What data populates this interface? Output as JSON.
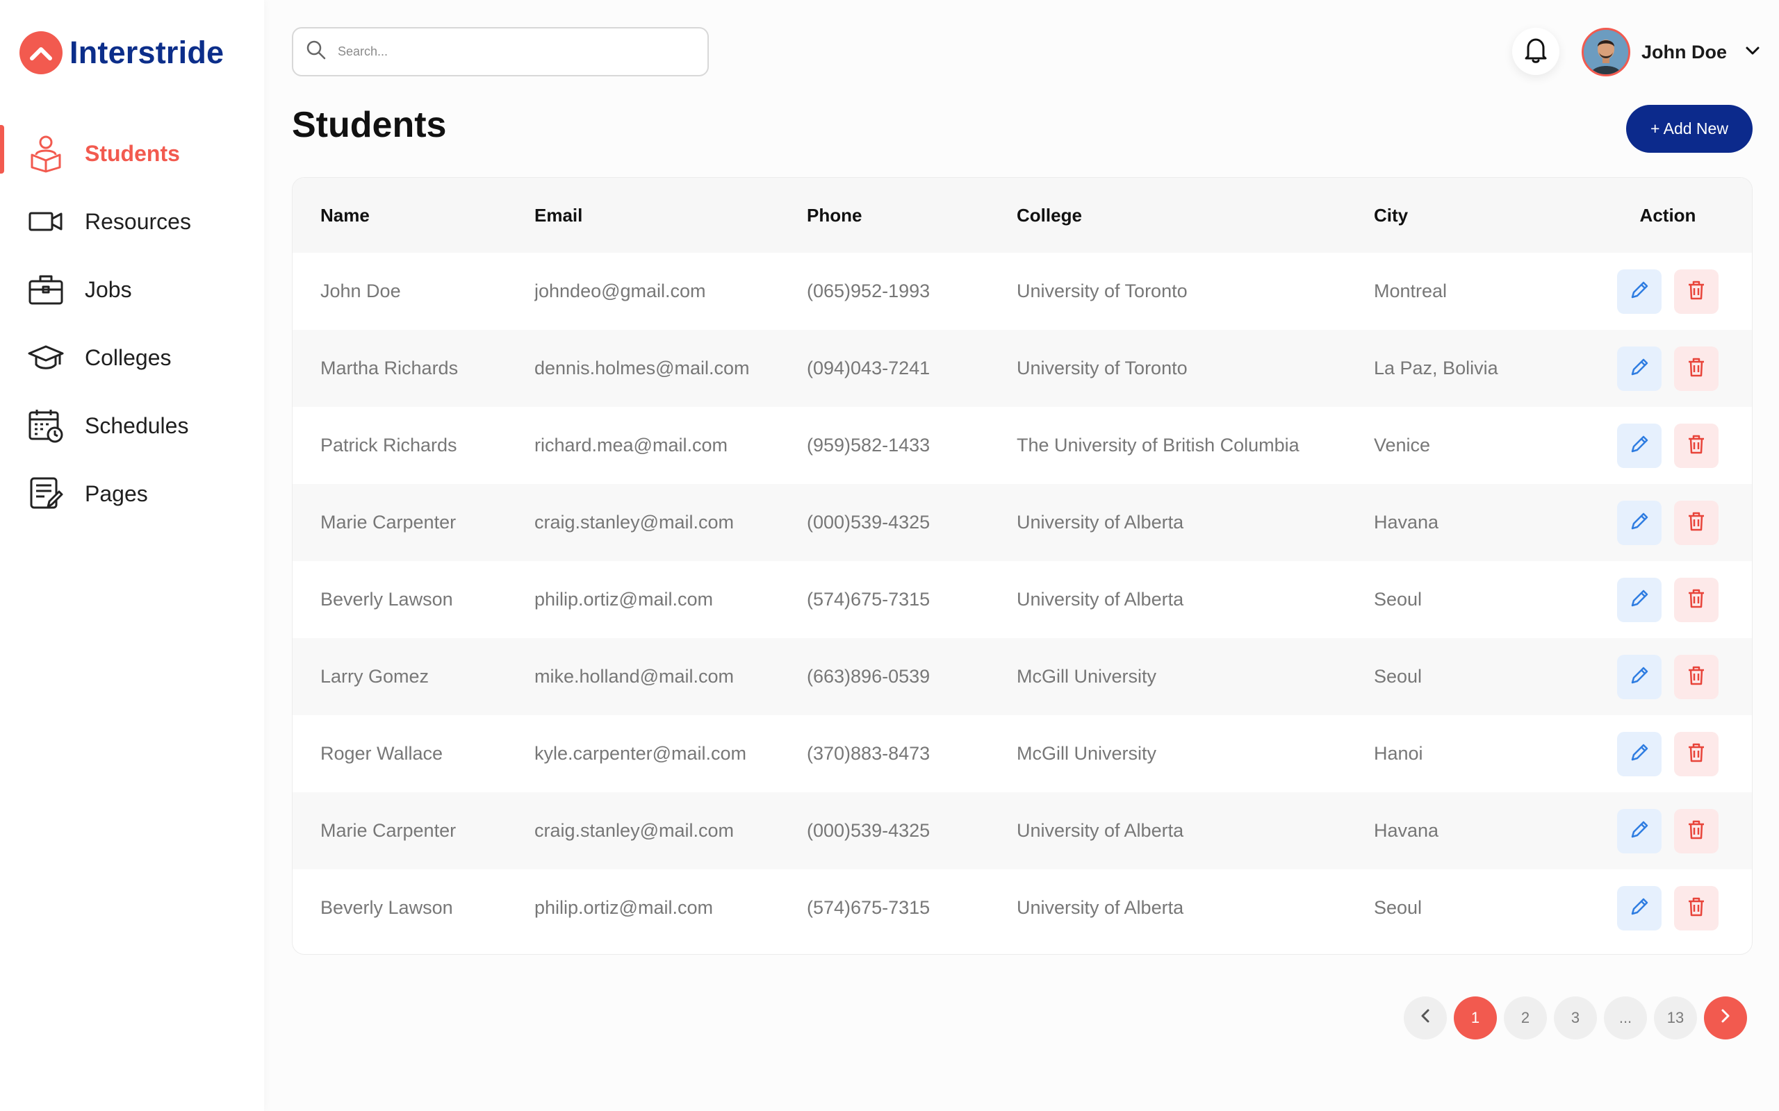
{
  "brand": {
    "name": "Interstride",
    "accent": "#f25a4f",
    "primary": "#0c2a8c"
  },
  "sidebar": {
    "items": [
      {
        "label": "Students",
        "icon": "student-icon",
        "active": true
      },
      {
        "label": "Resources",
        "icon": "video-camera-icon",
        "active": false
      },
      {
        "label": "Jobs",
        "icon": "briefcase-icon",
        "active": false
      },
      {
        "label": "Colleges",
        "icon": "graduation-cap-icon",
        "active": false
      },
      {
        "label": "Schedules",
        "icon": "calendar-clock-icon",
        "active": false
      },
      {
        "label": "Pages",
        "icon": "document-edit-icon",
        "active": false
      }
    ]
  },
  "header": {
    "search_placeholder": "Search...",
    "user_name": "John Doe"
  },
  "page": {
    "title": "Students",
    "add_button": "+ Add New"
  },
  "table": {
    "columns": [
      "Name",
      "Email",
      "Phone",
      "College",
      "City",
      "Action"
    ],
    "rows": [
      {
        "name": "John Doe",
        "email": "johndeo@gmail.com",
        "phone": "(065)952-1993",
        "college": "University of Toronto",
        "city": "Montreal"
      },
      {
        "name": "Martha Richards",
        "email": "dennis.holmes@mail.com",
        "phone": "(094)043-7241",
        "college": "University of Toronto",
        "city": "La Paz, Bolivia"
      },
      {
        "name": "Patrick Richards",
        "email": "richard.mea@mail.com",
        "phone": "(959)582-1433",
        "college": "The University of British Columbia",
        "city": "Venice"
      },
      {
        "name": "Marie Carpenter",
        "email": "craig.stanley@mail.com",
        "phone": "(000)539-4325",
        "college": "University of Alberta",
        "city": "Havana"
      },
      {
        "name": "Beverly Lawson",
        "email": "philip.ortiz@mail.com",
        "phone": "(574)675-7315",
        "college": "University of Alberta",
        "city": "Seoul"
      },
      {
        "name": "Larry Gomez",
        "email": "mike.holland@mail.com",
        "phone": "(663)896-0539",
        "college": "McGill University",
        "city": "Seoul"
      },
      {
        "name": "Roger Wallace",
        "email": "kyle.carpenter@mail.com",
        "phone": "(370)883-8473",
        "college": "McGill University",
        "city": "Hanoi"
      },
      {
        "name": "Marie Carpenter",
        "email": "craig.stanley@mail.com",
        "phone": "(000)539-4325",
        "college": "University of Alberta",
        "city": "Havana"
      },
      {
        "name": "Beverly Lawson",
        "email": "philip.ortiz@mail.com",
        "phone": "(574)675-7315",
        "college": "University of Alberta",
        "city": "Seoul"
      }
    ]
  },
  "pagination": {
    "pages": [
      "1",
      "2",
      "3",
      "...",
      "13"
    ],
    "current": "1"
  }
}
